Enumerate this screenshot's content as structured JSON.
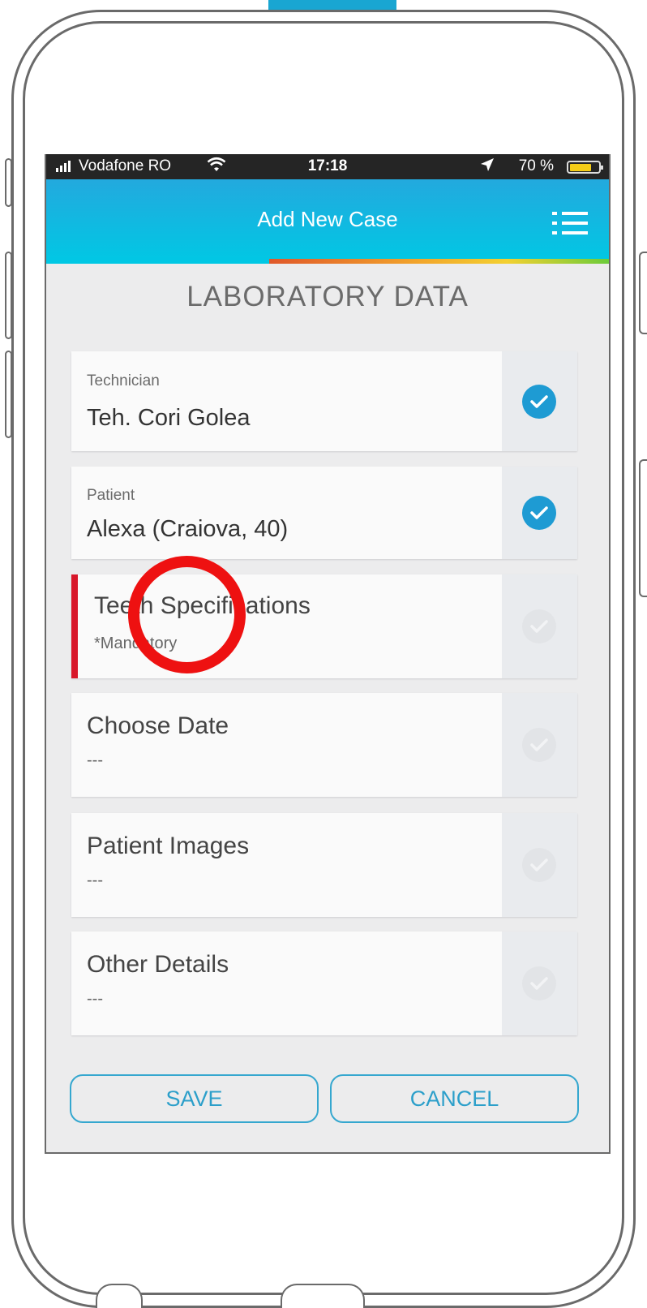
{
  "status_bar": {
    "carrier": "Vodafone RO",
    "time": "17:18",
    "battery": "70 %",
    "battery_level": 0.7,
    "signal_icon": "signal-bars-icon",
    "wifi_icon": "wifi-icon",
    "location_icon": "location-arrow-icon"
  },
  "header": {
    "title": "Add New Case",
    "menu_icon": "list-menu-icon",
    "colors": {
      "accent": "#1ea6dc",
      "progress_start": "#e0582a",
      "progress_end": "#6ccc3a"
    }
  },
  "section": {
    "title": "LABORATORY DATA"
  },
  "fields": [
    {
      "label": "Technician",
      "value": "Teh. Cori Golea",
      "completed": true
    },
    {
      "label": "Patient",
      "value": "Alexa (Craiova, 40)",
      "completed": true
    },
    {
      "label": "Teeth Specifications",
      "value": "*Mandatory",
      "completed": false,
      "required": true
    },
    {
      "label": "Choose Date",
      "value": "---",
      "completed": false
    },
    {
      "label": "Patient Images",
      "value": "---",
      "completed": false
    },
    {
      "label": "Other Details",
      "value": "---",
      "completed": false
    }
  ],
  "actions": {
    "save": "SAVE",
    "cancel": "CANCEL"
  },
  "colors": {
    "check_done": "#1e9bd3",
    "required_marker": "#d8172a",
    "highlight_ring": "#ee1111"
  }
}
